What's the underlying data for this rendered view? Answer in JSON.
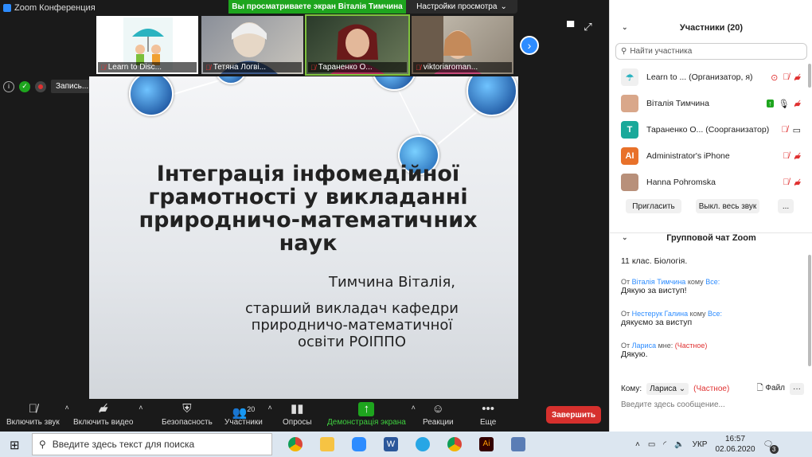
{
  "window": {
    "title": "Zoom Конференция",
    "banner": "Вы просматриваете экран Віталія Тимчина",
    "view_options": "Настройки просмотра",
    "controls": [
      "‒",
      "❐",
      "✕"
    ]
  },
  "thumbnails": [
    {
      "name": "Learn to Disc..."
    },
    {
      "name": "Тетяна Логві..."
    },
    {
      "name": "Тараненко О..."
    },
    {
      "name": "viktoriaroman..."
    }
  ],
  "recording": {
    "label": "Запись..."
  },
  "slide": {
    "title_lines": [
      "Інтеграція інфомедійної",
      "грамотності у викладанні",
      "природничо-математичних",
      "наук"
    ],
    "author": "Тимчина Віталія,",
    "position_lines": [
      "старший викладач кафедри",
      "природничо-математичної",
      "освіти РОІППО"
    ]
  },
  "toolbar": {
    "unmute": "Включить звук",
    "start_video": "Включить видео",
    "security": "Безопасность",
    "participants": "Участники",
    "participants_count": "20",
    "polls": "Опросы",
    "share_screen": "Демонстрація экрана",
    "reactions": "Реакции",
    "more": "Еще",
    "end": "Завершить"
  },
  "participants_panel": {
    "title": "Участники (20)",
    "search_placeholder": "Найти участника",
    "rows": [
      {
        "name": "Learn to ...  (Организатор, я)",
        "avatar": "",
        "color": "#f0f0f0"
      },
      {
        "name": "Віталія Тимчина",
        "avatar": "",
        "color": "#d9a78a"
      },
      {
        "name": "Тараненко О...  (Соорганизатор)",
        "avatar": "T",
        "color": "#1aa99a"
      },
      {
        "name": "Administrator's iPhone",
        "avatar": "AI",
        "color": "#e8712a"
      },
      {
        "name": "Hanna Pohromska",
        "avatar": "",
        "color": "#b8907a"
      }
    ],
    "invite": "Пригласить",
    "mute_all": "Выкл. весь звук",
    "more": "..."
  },
  "chat": {
    "title": "Групповой чат Zoom",
    "messages": [
      {
        "meta_from": "",
        "meta_to": "",
        "text": "11 клас. Біологія."
      },
      {
        "meta_prefix": "От",
        "meta_from": "Віталія Тимчина",
        "meta_mid": "кому",
        "meta_to": "Все:",
        "text": "Дякую за виступ!"
      },
      {
        "meta_prefix": "От",
        "meta_from": "Нестерук Галина",
        "meta_mid": "кому",
        "meta_to": "Все:",
        "text": "дякуємо за виступ"
      },
      {
        "meta_prefix": "От",
        "meta_from": "Лариса",
        "meta_mid": "мне:",
        "meta_to": "(Частное)",
        "text": "Дякую."
      }
    ],
    "to_label": "Кому:",
    "to_value": "Лариса",
    "private": "(Частное)",
    "file": "Файл",
    "more": "···",
    "input_placeholder": "Введите здесь сообщение..."
  },
  "taskbar": {
    "search_placeholder": "Введите здесь текст для поиска",
    "lang": "УКР",
    "time": "16:57",
    "date": "02.06.2020",
    "notifications": "3"
  }
}
